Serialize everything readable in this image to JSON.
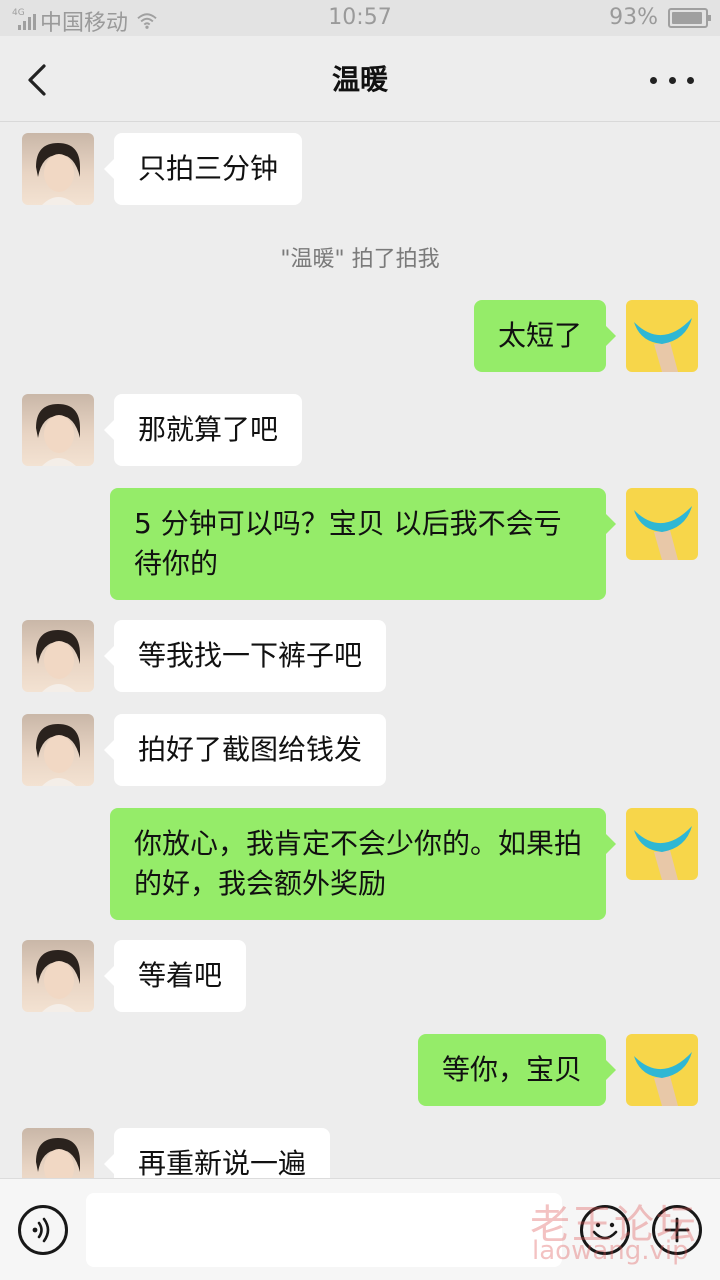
{
  "status_bar": {
    "network_type": "4G",
    "carrier": "中国移动",
    "time": "10:57",
    "battery": "93%",
    "battery_level": 0.93
  },
  "nav": {
    "title": "温暖"
  },
  "colors": {
    "incoming_bubble": "#ffffff",
    "outgoing_bubble": "#95ec69",
    "background": "#ededed"
  },
  "messages": [
    {
      "sender": "her",
      "text": "只拍三分钟"
    },
    {
      "sender": "system",
      "text": "\"温暖\" 拍了拍我"
    },
    {
      "sender": "me",
      "text": "太短了"
    },
    {
      "sender": "her",
      "text": "那就算了吧"
    },
    {
      "sender": "me",
      "text": "5 分钟可以吗？宝贝 以后我不会亏待你的"
    },
    {
      "sender": "her",
      "text": "等我找一下裤子吧"
    },
    {
      "sender": "her",
      "text": "拍好了截图给钱发"
    },
    {
      "sender": "me",
      "text": "你放心，我肯定不会少你的。如果拍的好，我会额外奖励"
    },
    {
      "sender": "her",
      "text": "等着吧"
    },
    {
      "sender": "me",
      "text": "等你，宝贝"
    },
    {
      "sender": "her",
      "text": "再重新说一遍"
    }
  ],
  "input": {
    "value": "",
    "placeholder": ""
  },
  "icons": {
    "back": "chevron-left-icon",
    "more": "more-dots-icon",
    "voice": "voice-icon",
    "emoji": "emoji-icon",
    "plus": "plus-icon",
    "my_avatar": "blue-banana-avatar",
    "her_avatar": "woman-portrait-avatar"
  },
  "watermark": {
    "cn": "老王论坛",
    "en": "laowang.vip"
  }
}
